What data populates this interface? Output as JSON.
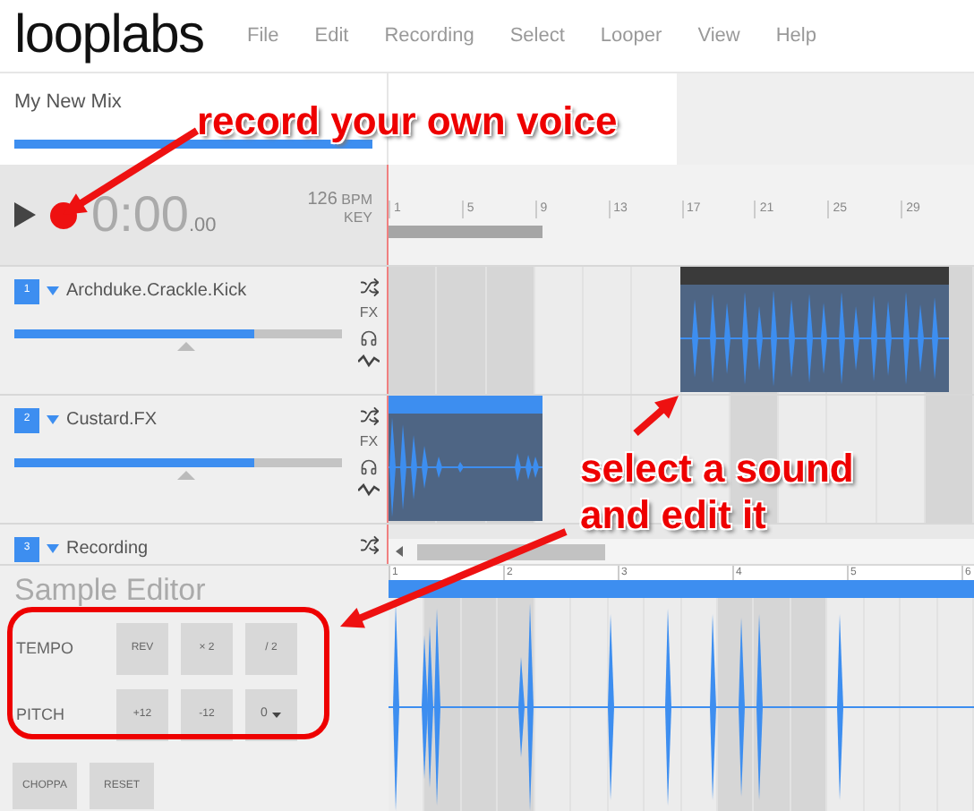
{
  "header": {
    "logo": "looplabs",
    "menu": [
      "File",
      "Edit",
      "Recording",
      "Select",
      "Looper",
      "View",
      "Help"
    ]
  },
  "mix": {
    "title": "My New Mix",
    "level": 1
  },
  "transport": {
    "time": "0:00",
    "fraction": ".00",
    "bpm": "126",
    "bpm_unit": "BPM",
    "key_label": "KEY"
  },
  "ruler": [
    "1",
    "5",
    "9",
    "13",
    "17",
    "21",
    "25",
    "29"
  ],
  "tracks": [
    {
      "number": "1",
      "name": "Archduke.Crackle.Kick",
      "level": 0.73,
      "fx": "FX",
      "clip": {
        "selected": true
      }
    },
    {
      "number": "2",
      "name": "Custard.FX",
      "level": 0.73,
      "fx": "FX",
      "clip": {
        "selected": false
      }
    },
    {
      "number": "3",
      "name": "Recording"
    }
  ],
  "sample_editor": {
    "title": "Sample Editor",
    "rows": [
      {
        "label": "TEMPO",
        "buttons": [
          "REV",
          "× 2",
          "/ 2"
        ]
      },
      {
        "label": "PITCH",
        "buttons": [
          "+12",
          "-12"
        ],
        "dropdown": "0"
      }
    ],
    "actions": [
      "CHOPPA",
      "RESET"
    ],
    "ruler": [
      "1",
      "2",
      "3",
      "4",
      "5",
      "6"
    ]
  },
  "annotations": [
    "record your own voice",
    "select a sound\nand edit it"
  ]
}
